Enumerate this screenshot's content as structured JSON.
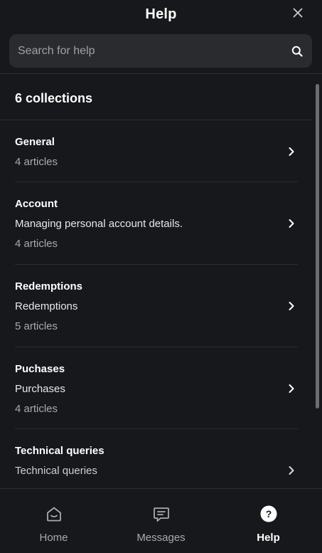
{
  "header": {
    "title": "Help"
  },
  "search": {
    "placeholder": "Search for help"
  },
  "collections": {
    "count_label": "6 collections",
    "items": [
      {
        "name": "General",
        "description": "",
        "count": "4 articles"
      },
      {
        "name": "Account",
        "description": "Managing personal account details.",
        "count": "4 articles"
      },
      {
        "name": "Redemptions",
        "description": "Redemptions",
        "count": "5 articles"
      },
      {
        "name": "Puchases",
        "description": "Purchases",
        "count": "4 articles"
      },
      {
        "name": "Technical queries",
        "description": "Technical queries",
        "count": ""
      }
    ]
  },
  "bottom_nav": {
    "active": "Help",
    "items": [
      {
        "label": "Home",
        "icon": "home-icon"
      },
      {
        "label": "Messages",
        "icon": "messages-icon"
      },
      {
        "label": "Help",
        "icon": "help-icon"
      }
    ]
  },
  "colors": {
    "background": "#17181b",
    "search_background": "#2a2b2f",
    "divider": "#2c2d31",
    "secondary_text": "#a9aaaf",
    "primary_text": "#ffffff"
  }
}
